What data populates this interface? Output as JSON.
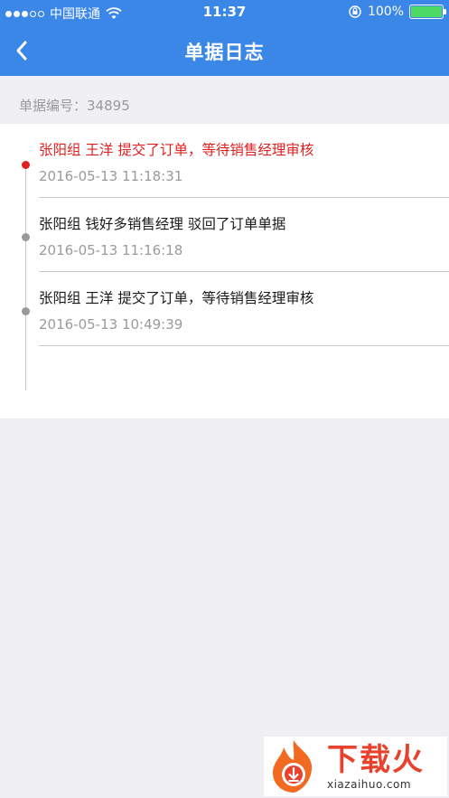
{
  "status_bar": {
    "carrier": "中国联通",
    "time": "11:37",
    "battery_percent": "100%",
    "battery_level": 1.0
  },
  "nav": {
    "title": "单据日志",
    "back_icon": "chevron-left-icon"
  },
  "order": {
    "label": "单据编号：",
    "number": "34895"
  },
  "logs": [
    {
      "text": "张阳组 王洋 提交了订单，等待销售经理审核",
      "time": "2016-05-13 11:18:31",
      "active": true
    },
    {
      "text": "张阳组 钱好多销售经理 驳回了订单单据",
      "time": "2016-05-13 11:16:18",
      "active": false
    },
    {
      "text": "张阳组 王洋 提交了订单，等待销售经理审核",
      "time": "2016-05-13 10:49:39",
      "active": false
    }
  ],
  "watermark": {
    "logo_text": "下载火",
    "url": "xiazaihuo.com"
  },
  "colors": {
    "nav_bg": "#3a87e8",
    "active_red": "#e02020",
    "muted_gray": "#9a9a9a",
    "page_bg": "#efeff4"
  }
}
